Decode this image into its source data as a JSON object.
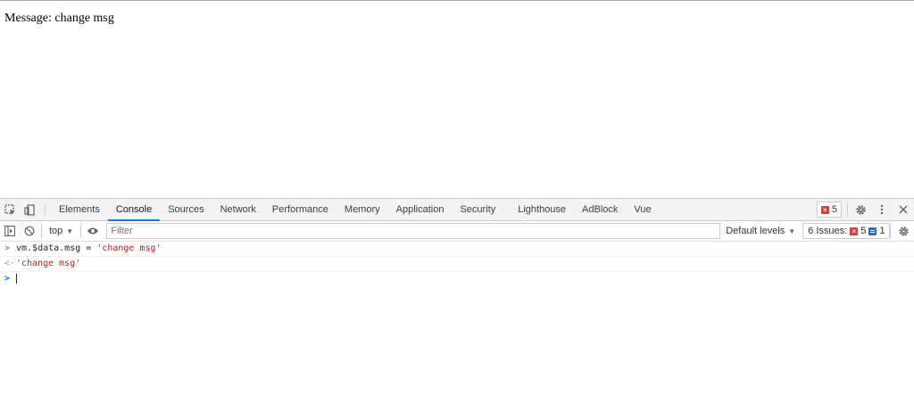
{
  "page": {
    "message_label": "Message:",
    "message_value": "change msg"
  },
  "devtools": {
    "tabs": [
      "Elements",
      "Console",
      "Sources",
      "Network",
      "Performance",
      "Memory",
      "Application",
      "Security",
      "Lighthouse",
      "AdBlock",
      "Vue"
    ],
    "active_tab": "Console",
    "error_count": "5",
    "toolbar": {
      "context": "top",
      "filter_placeholder": "Filter",
      "levels": "Default levels",
      "issues_label": "6 Issues:",
      "issues_errors": "5",
      "issues_info": "1"
    },
    "console": {
      "input_code": "vm.$data.msg = ",
      "input_string": "'change msg'",
      "result_string": "'change msg'"
    },
    "colors": {
      "accent": "#1a73e8",
      "error": "#e53935",
      "string": "#c41a16"
    }
  }
}
